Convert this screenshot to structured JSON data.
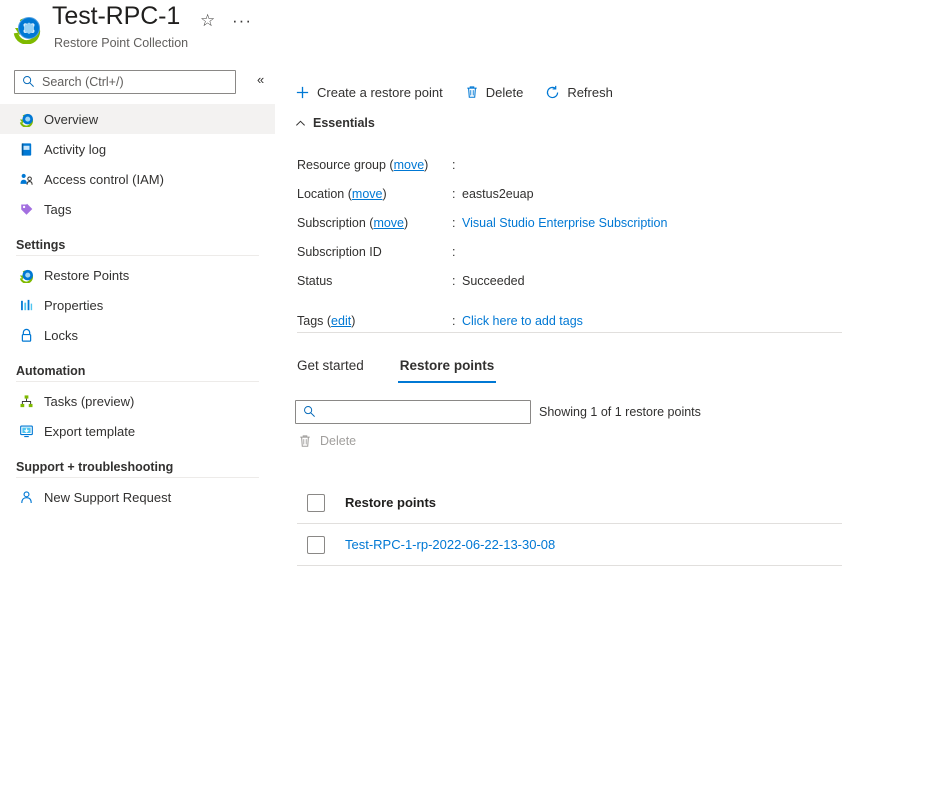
{
  "header": {
    "title": "Test-RPC-1",
    "subtitle": "Restore Point Collection",
    "favorite_label": "☆",
    "more_label": "···"
  },
  "search": {
    "placeholder": "Search (Ctrl+/)",
    "value": "",
    "collapse_label": "«"
  },
  "sidebar": {
    "items": [
      {
        "label": "Overview",
        "icon": "overview-icon",
        "selected": true
      },
      {
        "label": "Activity log",
        "icon": "activity-log-icon",
        "selected": false
      },
      {
        "label": "Access control (IAM)",
        "icon": "access-control-icon",
        "selected": false
      },
      {
        "label": "Tags",
        "icon": "tags-icon",
        "selected": false
      }
    ],
    "sections": [
      {
        "title": "Settings",
        "items": [
          {
            "label": "Restore Points",
            "icon": "restore-points-icon"
          },
          {
            "label": "Properties",
            "icon": "properties-icon"
          },
          {
            "label": "Locks",
            "icon": "lock-icon"
          }
        ]
      },
      {
        "title": "Automation",
        "items": [
          {
            "label": "Tasks (preview)",
            "icon": "tasks-icon"
          },
          {
            "label": "Export template",
            "icon": "export-template-icon"
          }
        ]
      },
      {
        "title": "Support + troubleshooting",
        "items": [
          {
            "label": "New Support Request",
            "icon": "support-request-icon"
          }
        ]
      }
    ]
  },
  "commandbar": {
    "create_label": "Create a restore point",
    "delete_label": "Delete",
    "refresh_label": "Refresh"
  },
  "essentials": {
    "header": "Essentials",
    "rows": [
      {
        "label": "Resource group",
        "link": "move",
        "value": "",
        "value_is_link": false
      },
      {
        "label": "Location",
        "link": "move",
        "value": "eastus2euap",
        "value_is_link": false
      },
      {
        "label": "Subscription",
        "link": "move",
        "value": "Visual Studio Enterprise Subscription",
        "value_is_link": true
      },
      {
        "label": "Subscription ID",
        "link": "",
        "value": "",
        "value_is_link": false
      },
      {
        "label": "Status",
        "link": "",
        "value": "Succeeded",
        "value_is_link": false
      }
    ],
    "tags": {
      "label": "Tags",
      "link": "edit",
      "value": "Click here to add tags"
    }
  },
  "tabs": [
    {
      "label": "Get started",
      "active": false
    },
    {
      "label": "Restore points",
      "active": true
    }
  ],
  "filter": {
    "placeholder": "",
    "value": "",
    "showing_text": "Showing 1 of 1 restore points",
    "delete_label": "Delete"
  },
  "table": {
    "column_header": "Restore points",
    "rows": [
      {
        "name": "Test-RPC-1-rp-2022-06-22-13-30-08",
        "checked": false
      }
    ]
  },
  "colors": {
    "accent": "#0078d4",
    "selected_row": "#f3f2f1",
    "divider": "#e1dfdd",
    "text": "#323130",
    "muted": "#605e5c",
    "disabled": "#a19f9d"
  }
}
